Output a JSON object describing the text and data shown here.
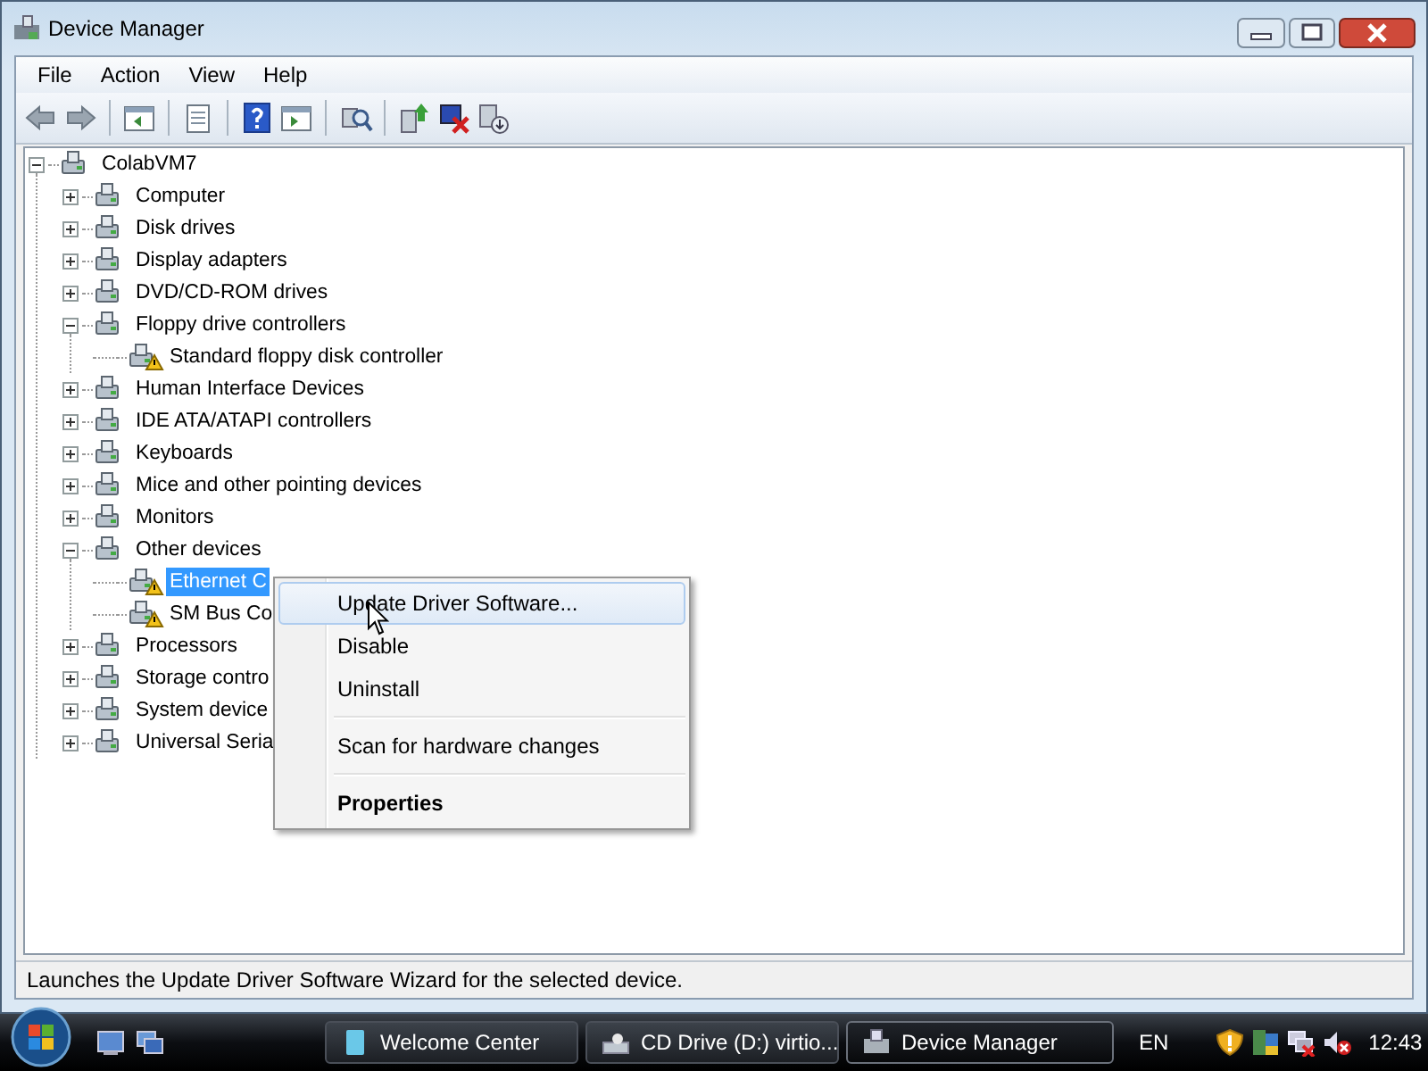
{
  "window": {
    "title": "Device Manager"
  },
  "menu_bar": [
    "File",
    "Action",
    "View",
    "Help"
  ],
  "tree": {
    "label": "ColabVM7",
    "expanded": true,
    "selected": false,
    "warning": false,
    "children": [
      {
        "label": "Computer",
        "expanded": false,
        "selected": false,
        "warning": false
      },
      {
        "label": "Disk drives",
        "expanded": false,
        "selected": false,
        "warning": false
      },
      {
        "label": "Display adapters",
        "expanded": false,
        "selected": false,
        "warning": false
      },
      {
        "label": "DVD/CD-ROM drives",
        "expanded": false,
        "selected": false,
        "warning": false
      },
      {
        "label": "Floppy drive controllers",
        "expanded": true,
        "selected": false,
        "warning": false,
        "children": [
          {
            "label": "Standard floppy disk controller",
            "selected": false,
            "warning": true
          }
        ]
      },
      {
        "label": "Human Interface Devices",
        "expanded": false,
        "selected": false,
        "warning": false
      },
      {
        "label": "IDE ATA/ATAPI controllers",
        "expanded": false,
        "selected": false,
        "warning": false
      },
      {
        "label": "Keyboards",
        "expanded": false,
        "selected": false,
        "warning": false
      },
      {
        "label": "Mice and other pointing devices",
        "expanded": false,
        "selected": false,
        "warning": false
      },
      {
        "label": "Monitors",
        "expanded": false,
        "selected": false,
        "warning": false
      },
      {
        "label": "Other devices",
        "expanded": true,
        "selected": false,
        "warning": false,
        "children": [
          {
            "label": "Ethernet C",
            "selected": true,
            "warning": true
          },
          {
            "label": "SM Bus Co",
            "selected": false,
            "warning": true
          }
        ]
      },
      {
        "label": "Processors",
        "expanded": false,
        "selected": false,
        "warning": false
      },
      {
        "label": "Storage contro",
        "expanded": false,
        "selected": false,
        "warning": false
      },
      {
        "label": "System device",
        "expanded": false,
        "selected": false,
        "warning": false
      },
      {
        "label": "Universal Seria",
        "expanded": false,
        "selected": false,
        "warning": false
      }
    ]
  },
  "context_menu": {
    "items": [
      {
        "kind": "item",
        "label": "Update Driver Software...",
        "selected": true,
        "default": false
      },
      {
        "kind": "item",
        "label": "Disable",
        "selected": false,
        "default": false
      },
      {
        "kind": "item",
        "label": "Uninstall",
        "selected": false,
        "default": false
      },
      {
        "kind": "separator"
      },
      {
        "kind": "item",
        "label": "Scan for hardware changes",
        "selected": false,
        "default": false
      },
      {
        "kind": "separator"
      },
      {
        "kind": "item",
        "label": "Properties",
        "selected": false,
        "default": true
      }
    ]
  },
  "status_bar": "Launches the Update Driver Software Wizard for the selected device.",
  "taskbar": {
    "tasks": [
      {
        "label": "Welcome Center",
        "selected": false
      },
      {
        "label": "CD Drive (D:) virtio...",
        "selected": false
      },
      {
        "label": "Device Manager",
        "selected": true
      }
    ],
    "language": "EN",
    "clock": "12:43"
  }
}
